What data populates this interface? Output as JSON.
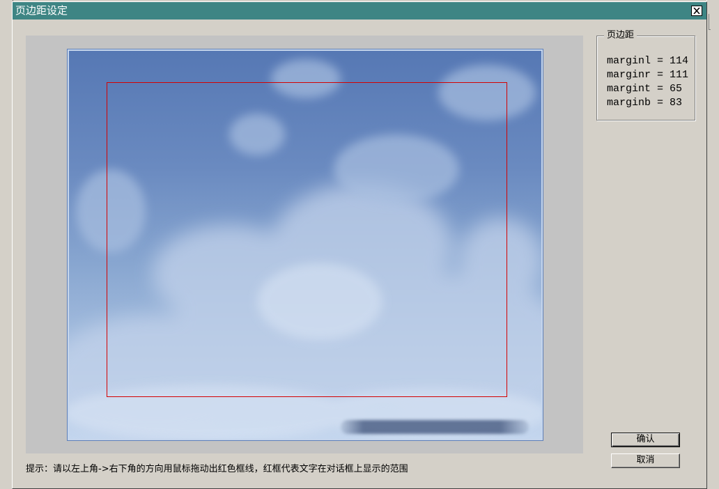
{
  "window": {
    "title": "页边距设定",
    "titlebar_color": "#3e8584"
  },
  "margins_group": {
    "legend": "页边距",
    "lines": [
      "marginl = 114",
      "marginr = 111",
      "margint = 65",
      "marginb = 83"
    ]
  },
  "buttons": {
    "ok_label": "确认",
    "cancel_label": "取消"
  },
  "hint": "提示：请以左上角->右下角的方向用鼠标拖动出红色框线，红框代表文字在对话框上显示的范围",
  "colors": {
    "margin_rect": "#d40000",
    "dialog_bg": "#d4d0c8"
  },
  "icons": {
    "close": "close-icon"
  }
}
